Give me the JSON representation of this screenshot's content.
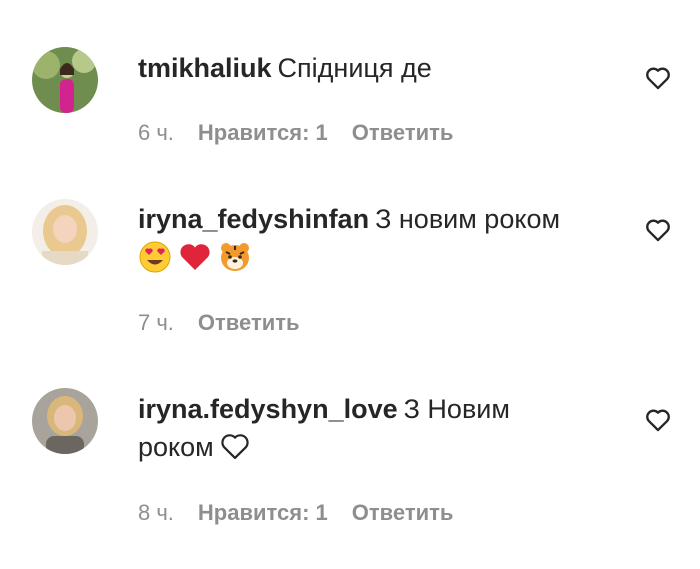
{
  "comments": [
    {
      "username": "tmikhaliuk",
      "text": "Спідниця де",
      "time": "6 ч.",
      "likes": "Нравится: 1",
      "reply": "Ответить",
      "emojis": []
    },
    {
      "username": "iryna_fedyshinfan",
      "text": "З новим роком",
      "time": "7 ч.",
      "reply": "Ответить",
      "emojis": [
        "heart-eyes-emoji",
        "red-heart-emoji",
        "tiger-face-emoji"
      ]
    },
    {
      "username": "iryna.fedyshyn_love",
      "text_line1": "З Новим",
      "text_line2": "роком",
      "time": "8 ч.",
      "likes": "Нравится: 1",
      "reply": "Ответить"
    }
  ]
}
